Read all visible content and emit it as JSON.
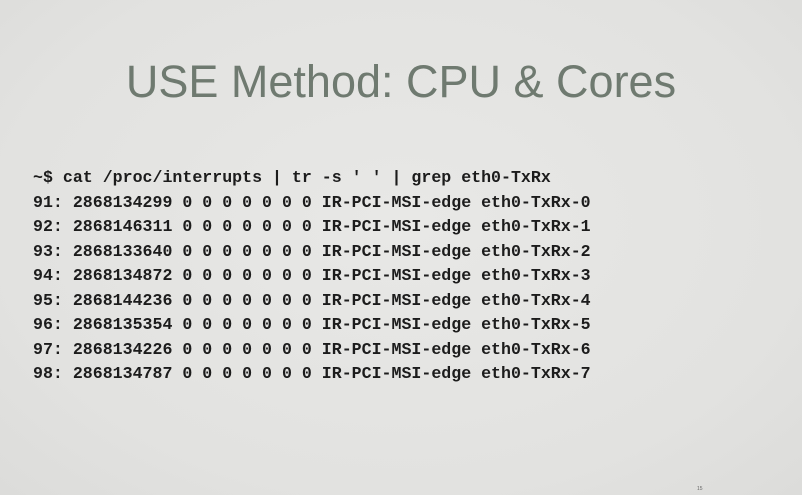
{
  "slide": {
    "title": "USE Method: CPU & Cores",
    "terminal_lines": [
      "~$ cat /proc/interrupts | tr -s ' ' | grep eth0-TxRx",
      "91: 2868134299 0 0 0 0 0 0 0 IR-PCI-MSI-edge eth0-TxRx-0",
      "92: 2868146311 0 0 0 0 0 0 0 IR-PCI-MSI-edge eth0-TxRx-1",
      "93: 2868133640 0 0 0 0 0 0 0 IR-PCI-MSI-edge eth0-TxRx-2",
      "94: 2868134872 0 0 0 0 0 0 0 IR-PCI-MSI-edge eth0-TxRx-3",
      "95: 2868144236 0 0 0 0 0 0 0 IR-PCI-MSI-edge eth0-TxRx-4",
      "96: 2868135354 0 0 0 0 0 0 0 IR-PCI-MSI-edge eth0-TxRx-5",
      "97: 2868134226 0 0 0 0 0 0 0 IR-PCI-MSI-edge eth0-TxRx-6",
      "98: 2868134787 0 0 0 0 0 0 0 IR-PCI-MSI-edge eth0-TxRx-7"
    ],
    "slide_number": "15"
  },
  "colors": {
    "background": "#e4e4e2",
    "title": "#6f7a70",
    "terminal_text": "#1c1c1c"
  }
}
